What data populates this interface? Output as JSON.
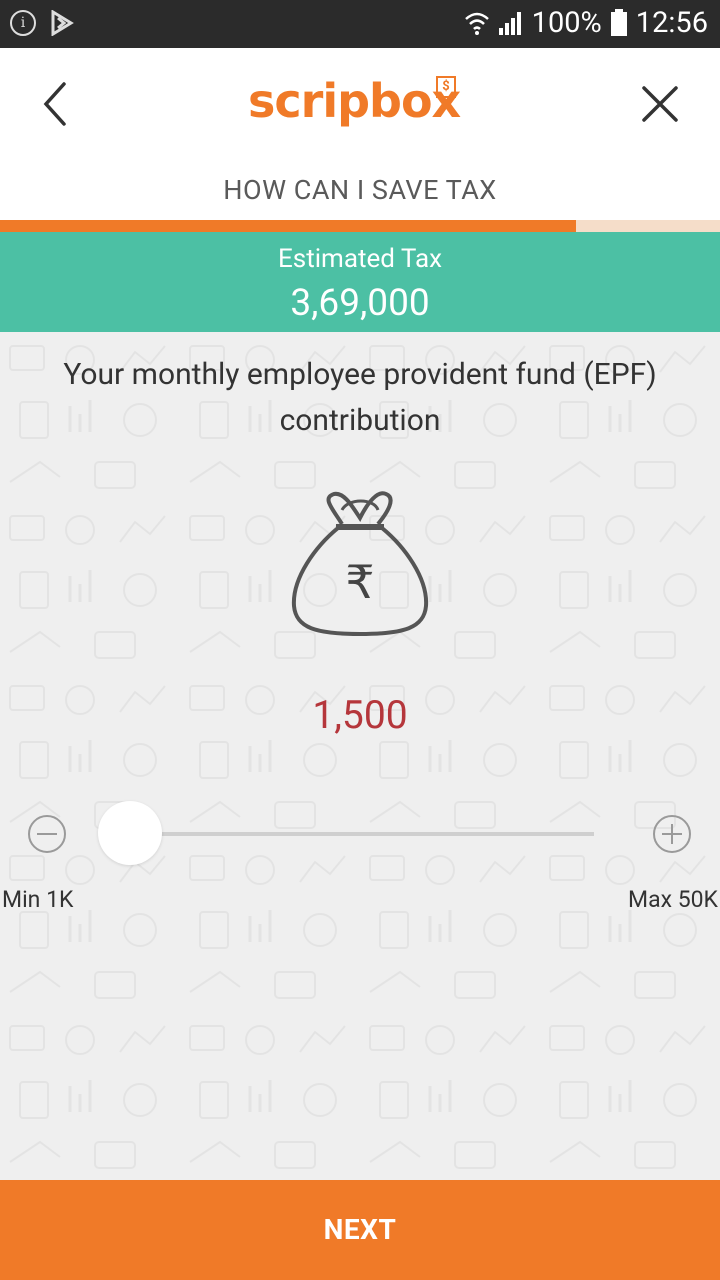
{
  "status_bar": {
    "battery": "100%",
    "time": "12:56"
  },
  "header": {
    "logo_text": "scripbox",
    "logo_badge": "$"
  },
  "subtitle": "HOW CAN I SAVE TAX",
  "progress": {
    "fraction": 0.8
  },
  "estimated_tax": {
    "label": "Estimated Tax",
    "value": "3,69,000"
  },
  "question": "Your monthly employee provident fund (EPF) contribution",
  "amount": "1,500",
  "slider": {
    "min_label": "Min 1K",
    "max_label": "Max 50K",
    "value": 1500,
    "min": 1000,
    "max": 50000
  },
  "next_label": "NEXT",
  "colors": {
    "brand_orange": "#f07a28",
    "teal": "#4cc0a4",
    "amount_red": "#b5363b"
  },
  "icons": [
    "info-icon",
    "play-store-icon",
    "wifi-icon",
    "signal-icon",
    "battery-icon",
    "back-arrow-icon",
    "close-icon",
    "money-bag-icon",
    "minus-icon",
    "plus-icon"
  ]
}
